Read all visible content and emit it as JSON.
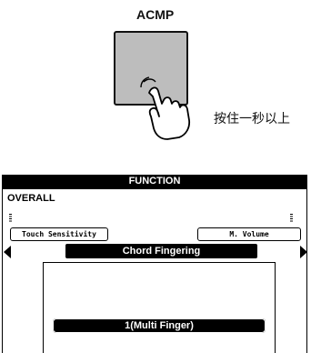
{
  "button": {
    "label": "ACMP",
    "instruction": "按住一秒以上"
  },
  "display": {
    "header": "FUNCTION",
    "section": "OVERALL",
    "left_param": "Touch Sensitivity",
    "right_param": "M. Volume",
    "overlay_title": "Chord Fingering",
    "overlay_value": "1(Multi Finger)"
  },
  "icons": {
    "hand": "pointing-hand-press-icon",
    "left_arrow": "triangle-left-icon",
    "right_arrow": "triangle-right-icon"
  },
  "colors": {
    "button_fill": "#bdbdbd",
    "lcd_dark": "#000000",
    "background": "#ffffff"
  }
}
